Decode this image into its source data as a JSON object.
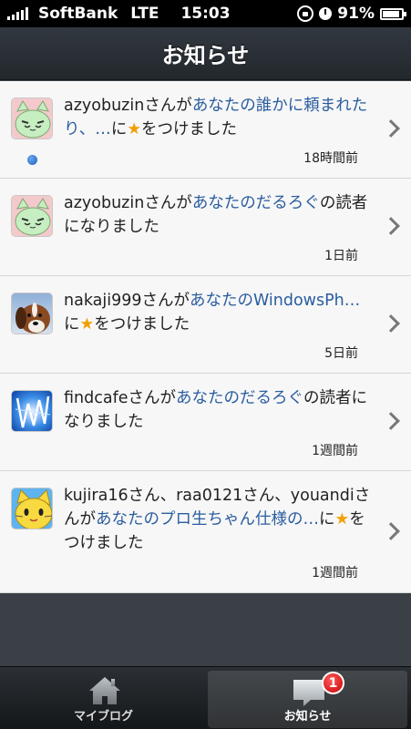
{
  "status_bar": {
    "carrier": "SoftBank",
    "network": "LTE",
    "time": "15:03",
    "battery_percent": "91%",
    "battery_level": 0.91
  },
  "nav": {
    "title": "お知らせ"
  },
  "notifications": [
    {
      "user": "azyobuzin",
      "pre": "さんが",
      "link": "あなたの誰かに頼まれたり、…",
      "post_pre": "に",
      "star": "★",
      "post": "をつけました",
      "time": "18時間前",
      "unread": true,
      "avatar_icon": "green-cat-avatar-icon"
    },
    {
      "user": "azyobuzin",
      "pre": "さんが",
      "link": "あなたのだるろぐ",
      "post_pre": "の",
      "post": "読者になりました",
      "time": "1日前",
      "unread": false,
      "avatar_icon": "green-cat-avatar-icon"
    },
    {
      "user": "nakaji999",
      "pre": "さんが",
      "link": "あなたのWindowsPh…",
      "post_pre": "に",
      "star": "★",
      "post": "をつけました",
      "time": "5日前",
      "unread": false,
      "avatar_icon": "dog-photo-avatar-icon"
    },
    {
      "user": "findcafe",
      "pre": "さんが",
      "link": "あなたのだるろぐ",
      "post_pre": "の",
      "post": "読者になりました",
      "time": "1週間前",
      "unread": false,
      "avatar_icon": "blue-lightning-avatar-icon"
    },
    {
      "user": "kujira16さん、raa0121さん、youandi",
      "pre": "さんが",
      "link": "あなたのプロ生ちゃん仕様の…",
      "post_pre": "に",
      "star": "★",
      "post": "をつけました",
      "time": "1週間前",
      "unread": false,
      "avatar_icon": "yellow-cat-avatar-icon"
    }
  ],
  "tabs": [
    {
      "label": "マイブログ",
      "icon": "home-icon",
      "selected": false
    },
    {
      "label": "お知らせ",
      "icon": "message-icon",
      "selected": true,
      "badge": "1"
    }
  ],
  "colors": {
    "link": "#2a5d9f",
    "star": "#f0a000",
    "badge": "#d40000"
  }
}
